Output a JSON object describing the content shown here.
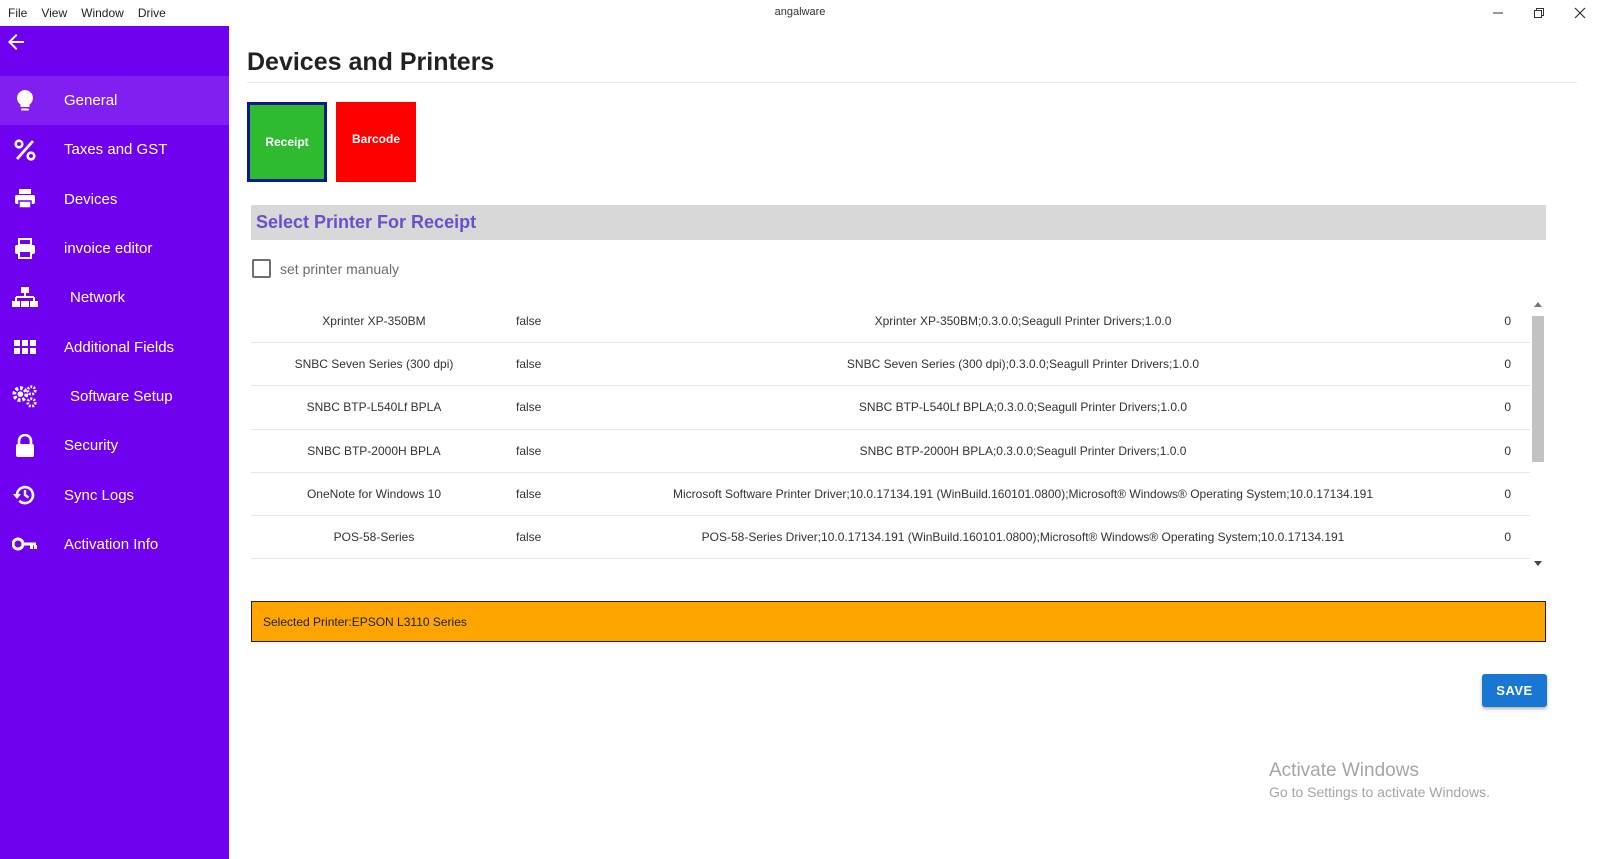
{
  "window": {
    "title": "angalware",
    "menu": [
      "File",
      "View",
      "Window",
      "Drive"
    ]
  },
  "sidebar": {
    "items": [
      {
        "label": "General",
        "icon": "lightbulb-icon",
        "active": true
      },
      {
        "label": "Taxes and GST",
        "icon": "percent-icon"
      },
      {
        "label": "Devices",
        "icon": "printer-icon"
      },
      {
        "label": "invoice editor",
        "icon": "printer-outline-icon"
      },
      {
        "label": "Network",
        "icon": "network-icon"
      },
      {
        "label": "Additional Fields",
        "icon": "grid-icon"
      },
      {
        "label": "Software Setup",
        "icon": "gears-icon"
      },
      {
        "label": "Security",
        "icon": "lock-icon"
      },
      {
        "label": "Sync Logs",
        "icon": "history-icon"
      },
      {
        "label": "Activation Info",
        "icon": "key-icon"
      }
    ]
  },
  "main": {
    "title": "Devices and Printers",
    "device_types": [
      {
        "label": "Receipt",
        "color": "#2fbb2f",
        "selected": true
      },
      {
        "label": "Barcode",
        "color": "#ff0000",
        "selected": false
      }
    ],
    "section_title": "Select Printer For Receipt",
    "manual_checkbox_label": "set printer manualy",
    "printers": [
      {
        "name": "Xprinter XP-350BM",
        "default": "false",
        "driver": "Xprinter XP-350BM;0.3.0.0;Seagull Printer Drivers;1.0.0",
        "status": "0"
      },
      {
        "name": "SNBC Seven Series (300 dpi)",
        "default": "false",
        "driver": "SNBC Seven Series (300 dpi);0.3.0.0;Seagull Printer Drivers;1.0.0",
        "status": "0"
      },
      {
        "name": "SNBC BTP-L540Lf BPLA",
        "default": "false",
        "driver": "SNBC BTP-L540Lf BPLA;0.3.0.0;Seagull Printer Drivers;1.0.0",
        "status": "0"
      },
      {
        "name": "SNBC BTP-2000H BPLA",
        "default": "false",
        "driver": "SNBC BTP-2000H BPLA;0.3.0.0;Seagull Printer Drivers;1.0.0",
        "status": "0"
      },
      {
        "name": "OneNote for Windows 10",
        "default": "false",
        "driver": "Microsoft Software Printer Driver;10.0.17134.191 (WinBuild.160101.0800);Microsoft® Windows® Operating System;10.0.17134.191",
        "status": "0"
      },
      {
        "name": "POS-58-Series",
        "default": "false",
        "driver": "POS-58-Series Driver;10.0.17134.191 (WinBuild.160101.0800);Microsoft® Windows® Operating System;10.0.17134.191",
        "status": "0"
      }
    ],
    "selected_printer_text": "Selected Printer:EPSON L3110 Series",
    "save_label": "SAVE"
  },
  "watermark": {
    "title": "Activate Windows",
    "subtitle": "Go to Settings to activate Windows."
  },
  "colors": {
    "sidebar": "#7000f0",
    "section_title": "#6a4fc8",
    "selected_bar": "#ffa500",
    "save_button": "#1976d2"
  }
}
